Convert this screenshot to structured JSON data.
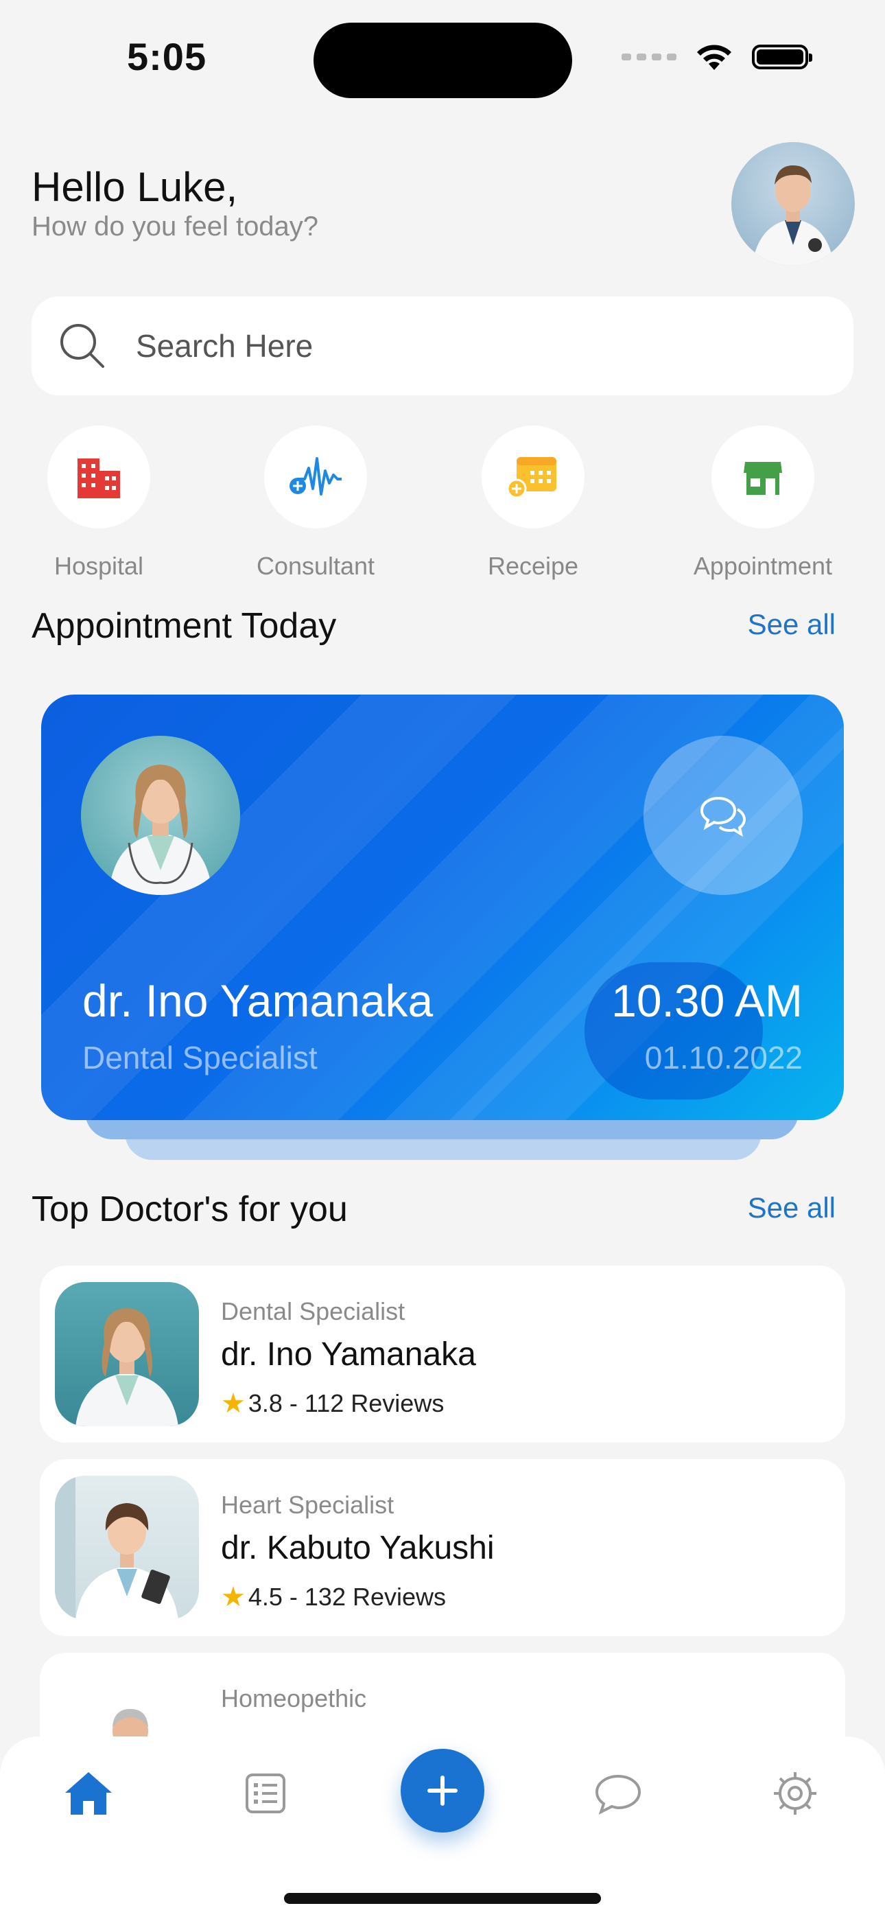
{
  "status_bar": {
    "time": "5:05"
  },
  "header": {
    "greeting": "Hello Luke,",
    "subtitle": "How do you feel today?"
  },
  "search": {
    "placeholder": "Search Here"
  },
  "categories": [
    {
      "label": "Hospital",
      "icon": "hospital-building-icon",
      "color": "#e53935"
    },
    {
      "label": "Consultant",
      "icon": "heartbeat-plus-icon",
      "color": "#1e88e5"
    },
    {
      "label": "Receipe",
      "icon": "calendar-plus-icon",
      "color": "#fbc02d"
    },
    {
      "label": "Appointment",
      "icon": "store-icon",
      "color": "#43a047"
    }
  ],
  "appointment_section": {
    "title": "Appointment Today",
    "see_all": "See all"
  },
  "appointment": {
    "doctor": "dr. Ino Yamanaka",
    "specialty": "Dental Specialist",
    "time": "10.30 AM",
    "date": "01.10.2022"
  },
  "doctors_section": {
    "title": "Top Doctor's for you",
    "see_all": "See all"
  },
  "doctors": [
    {
      "specialty": "Dental Specialist",
      "name": "dr. Ino Yamanaka",
      "rating": "3.8 - 112 Reviews"
    },
    {
      "specialty": "Heart Specialist",
      "name": "dr. Kabuto Yakushi",
      "rating": "4.5 - 132 Reviews"
    },
    {
      "specialty": "Homeopethic",
      "name": "",
      "rating": ""
    }
  ],
  "nav": {
    "accent": "#1a73d0",
    "inactive": "#9a9a9a"
  }
}
